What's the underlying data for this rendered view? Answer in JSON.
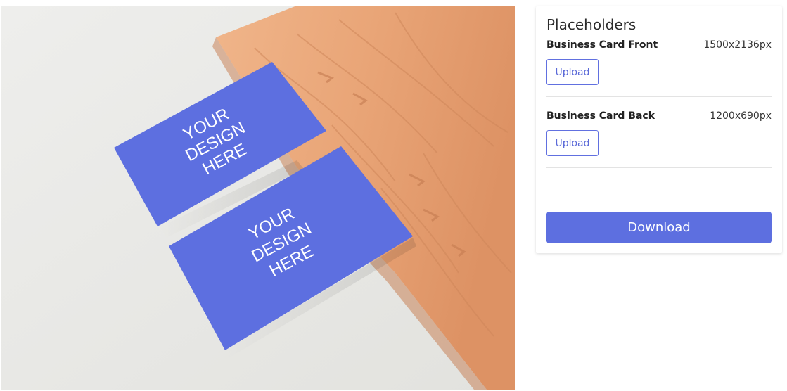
{
  "preview": {
    "card_front_text": [
      "YOUR",
      "DESIGN",
      "HERE"
    ],
    "card_back_text": [
      "YOUR",
      "DESIGN",
      "HERE"
    ],
    "card_color": "#5d6fe0",
    "wood_color": "#e8a070"
  },
  "panel": {
    "title": "Placeholders",
    "placeholders": [
      {
        "name": "Business Card Front",
        "size": "1500x2136px",
        "button_label": "Upload"
      },
      {
        "name": "Business Card Back",
        "size": "1200x690px",
        "button_label": "Upload"
      }
    ],
    "download_label": "Download"
  },
  "colors": {
    "accent": "#5d6fe0",
    "panel_bg": "#ffffff"
  }
}
